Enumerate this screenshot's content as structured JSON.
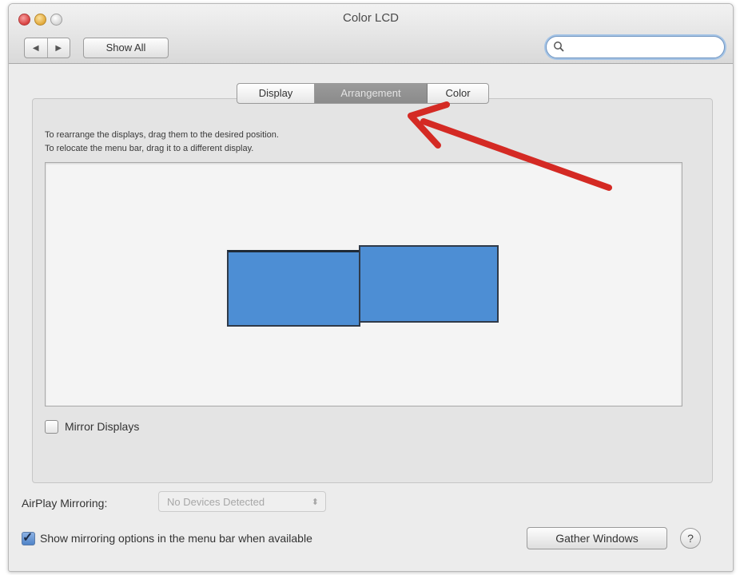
{
  "window": {
    "title": "Color LCD"
  },
  "toolbar": {
    "back_icon": "◀",
    "forward_icon": "▶",
    "show_all_label": "Show All",
    "search_placeholder": ""
  },
  "tabs": [
    {
      "label": "Display",
      "selected": false
    },
    {
      "label": "Arrangement",
      "selected": true
    },
    {
      "label": "Color",
      "selected": false
    }
  ],
  "arrangement": {
    "instruction_line_1": "To rearrange the displays, drag them to the desired position.",
    "instruction_line_2": "To relocate the menu bar, drag it to a different display.",
    "display_color": "#4d8ed4"
  },
  "mirror_displays": {
    "label": "Mirror Displays",
    "checked": false
  },
  "airplay": {
    "label": "AirPlay Mirroring:",
    "selected_value": "No Devices Detected",
    "chevron": "⬍"
  },
  "show_mirroring": {
    "label": "Show mirroring options in the menu bar when available",
    "checked": true,
    "check_glyph": "✓"
  },
  "buttons": {
    "gather_windows": "Gather Windows",
    "help": "?"
  },
  "annotation": {
    "arrow_color": "#d42a24"
  }
}
